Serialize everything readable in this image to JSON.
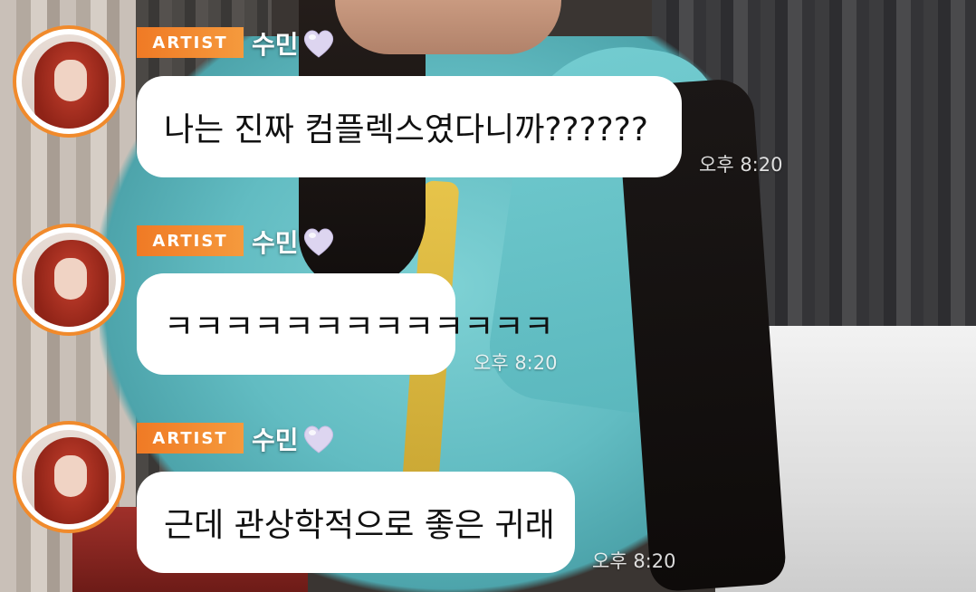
{
  "messages": [
    {
      "badge": "ARTIST",
      "name": "수민",
      "heart_icon": "purple-heart-icon",
      "text": "나는 진짜 컴플렉스였다니까??????",
      "time": "오후 8:20"
    },
    {
      "badge": "ARTIST",
      "name": "수민",
      "heart_icon": "purple-heart-icon",
      "text": "ㅋㅋㅋㅋㅋㅋㅋㅋㅋㅋㅋㅋㅋ",
      "time": "오후 8:20"
    },
    {
      "badge": "ARTIST",
      "name": "수민",
      "heart_icon": "purple-heart-icon",
      "text": "근데 관상학적으로 좋은 귀래",
      "time": "오후 8:20"
    }
  ],
  "colors": {
    "badge": "#f07a25",
    "avatar_ring": "#f08a2c",
    "bubble": "#ffffff",
    "heart": "#d8d0ee"
  }
}
